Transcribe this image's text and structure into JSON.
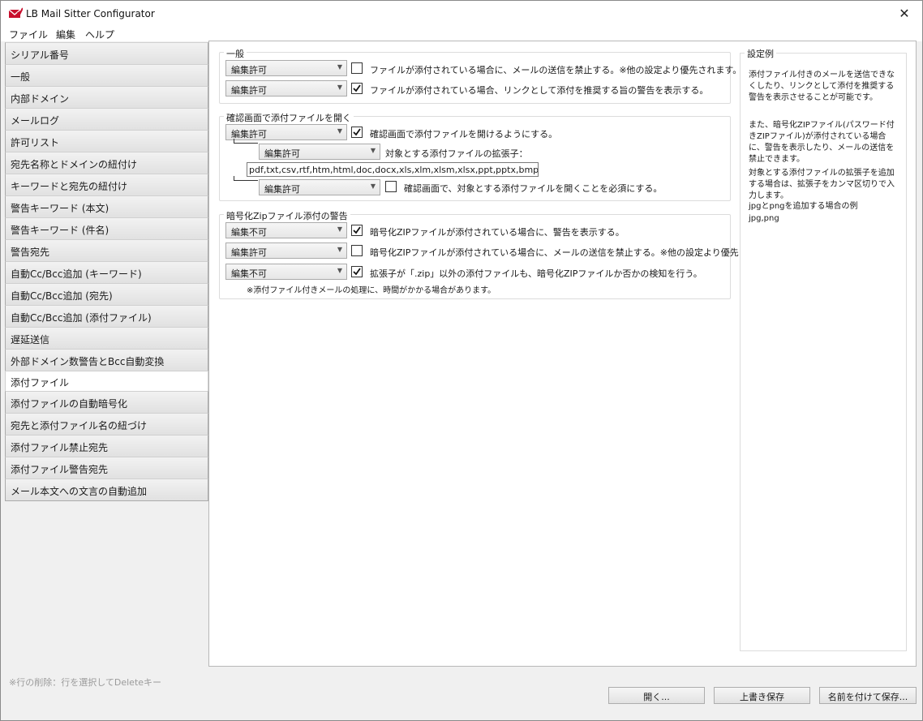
{
  "window": {
    "title": "LB Mail Sitter Configurator",
    "close_glyph": "✕"
  },
  "menu": [
    "ファイル",
    "編集",
    "ヘルプ"
  ],
  "sidebar": {
    "items": [
      "シリアル番号",
      "一般",
      "内部ドメイン",
      "メールログ",
      "許可リスト",
      "宛先名称とドメインの紐付け",
      "キーワードと宛先の紐付け",
      "警告キーワード (本文)",
      "警告キーワード (件名)",
      "警告宛先",
      "自動Cc/Bcc追加 (キーワード)",
      "自動Cc/Bcc追加 (宛先)",
      "自動Cc/Bcc追加 (添付ファイル)",
      "遅延送信",
      "外部ドメイン数警告とBcc自動変換",
      "添付ファイル",
      "添付ファイルの自動暗号化",
      "宛先と添付ファイル名の紐づけ",
      "添付ファイル禁止宛先",
      "添付ファイル警告宛先",
      "メール本文への文言の自動追加"
    ],
    "active": "添付ファイル"
  },
  "groups": {
    "general": {
      "title": "一般",
      "rows": [
        {
          "dropdown": "編集許可",
          "checked": false,
          "label": "ファイルが添付されている場合に、メールの送信を禁止する。※他の設定より優先されます。"
        },
        {
          "dropdown": "編集許可",
          "checked": true,
          "label": "ファイルが添付されている場合、リンクとして添付を推奨する旨の警告を表示する。"
        }
      ]
    },
    "confirm": {
      "title": "確認画面で添付ファイルを開く",
      "row1": {
        "dropdown": "編集許可",
        "checked": true,
        "label": "確認画面で添付ファイルを開けるようにする。"
      },
      "row2": {
        "dropdown": "編集許可",
        "label": "対象とする添付ファイルの拡張子："
      },
      "extensions": "pdf,txt,csv,rtf,htm,html,doc,docx,xls,xlm,xlsm,xlsx,ppt,pptx,bmp,gif,jpg,jpeg",
      "row3": {
        "dropdown": "編集許可",
        "checked": false,
        "label": "確認画面で、対象とする添付ファイルを開くことを必須にする。"
      }
    },
    "zip": {
      "title": "暗号化Zipファイル添付の警告",
      "rows": [
        {
          "dropdown": "編集不可",
          "checked": true,
          "label": "暗号化ZIPファイルが添付されている場合に、警告を表示する。"
        },
        {
          "dropdown": "編集許可",
          "checked": false,
          "label": "暗号化ZIPファイルが添付されている場合に、メールの送信を禁止する。※他の設定より優先されます。"
        },
        {
          "dropdown": "編集不可",
          "checked": true,
          "label": "拡張子が「.zip」以外の添付ファイルも、暗号化ZIPファイルか否かの検知を行う。"
        }
      ],
      "note": "※添付ファイル付きメールの処理に、時間がかかる場合があります。"
    }
  },
  "example": {
    "title": "設定例",
    "p1": "添付ファイル付きのメールを送信できなくしたり、リンクとして添付を推奨する警告を表示させることが可能です。",
    "p2": "また、暗号化ZIPファイル(パスワード付きZIPファイル)が添付されている場合に、警告を表示したり、メールの送信を禁止できます。",
    "p3": "対象とする添付ファイルの拡張子を追加する場合は、拡張子をカンマ区切りで入力します。",
    "p4": "jpgとpngを追加する場合の例",
    "p5": "jpg,png"
  },
  "footer": {
    "hint": "※行の削除：行を選択してDeleteキー",
    "open": "開く...",
    "overwrite": "上書き保存",
    "save_as": "名前を付けて保存..."
  }
}
